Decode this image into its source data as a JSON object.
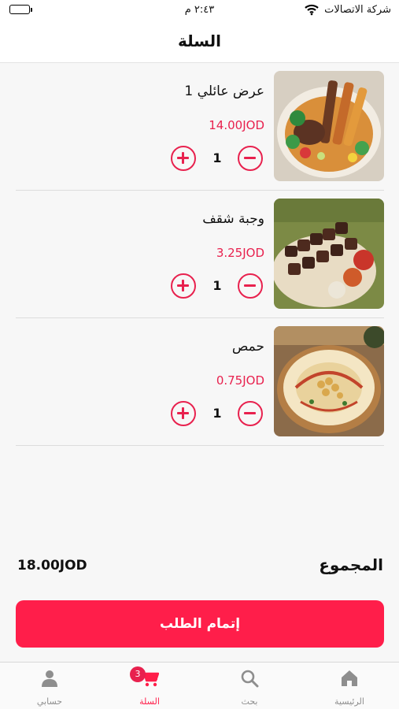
{
  "status_bar": {
    "carrier": "شركة الاتصالات",
    "time": "٢:٤٣ م"
  },
  "header": {
    "title": "السلة"
  },
  "cart": {
    "items": [
      {
        "name": "عرض عائلي 1",
        "price": "14.00JOD",
        "quantity": "1",
        "image_icon": "mixed-grill-platter-photo"
      },
      {
        "name": "وجبة شقف",
        "price": "3.25JOD",
        "quantity": "1",
        "image_icon": "shish-kebab-photo"
      },
      {
        "name": "حمص",
        "price": "0.75JOD",
        "quantity": "1",
        "image_icon": "hummus-bowl-photo"
      }
    ]
  },
  "summary": {
    "total_label": "المجموع",
    "total_amount": "18.00JOD"
  },
  "checkout": {
    "label": "إتمام الطلب"
  },
  "tabbar": {
    "tabs": [
      {
        "label": "الرئيسية",
        "icon": "home-icon",
        "active": false
      },
      {
        "label": "بحث",
        "icon": "search-icon",
        "active": false
      },
      {
        "label": "السلة",
        "icon": "cart-icon",
        "active": true,
        "badge": "3"
      },
      {
        "label": "حسابي",
        "icon": "user-icon",
        "active": false
      }
    ]
  },
  "colors": {
    "accent": "#e8214e",
    "button": "#ff1e4a",
    "inactive_tab": "#8e8e8e"
  }
}
